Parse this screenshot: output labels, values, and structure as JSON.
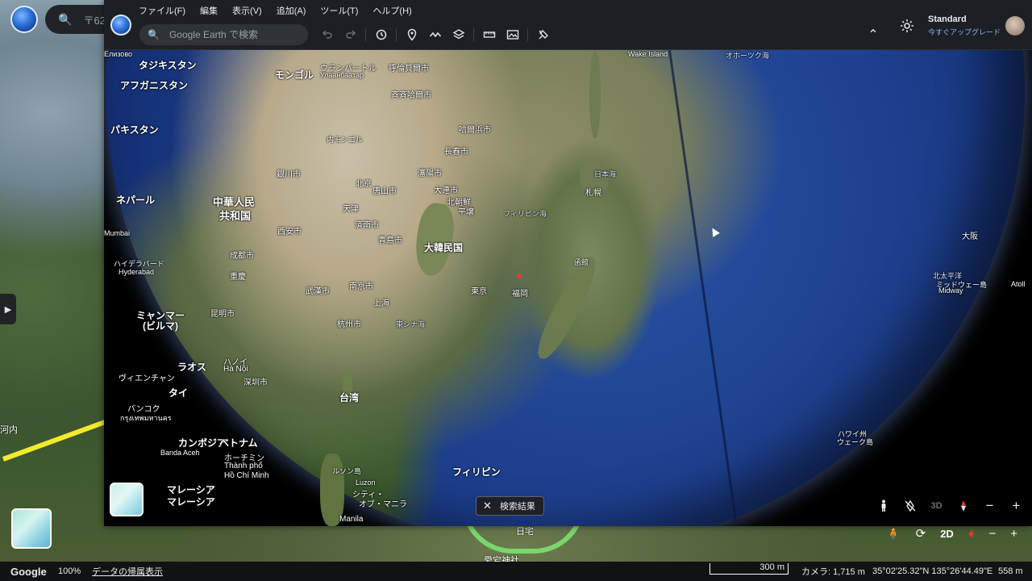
{
  "background": {
    "search_placeholder": "〒62",
    "label_left": "河内",
    "place_label_1": "日宅",
    "place_label_2": "愛宕神社",
    "controls": {
      "mode": "2D"
    },
    "status": {
      "google": "Google",
      "zoom": "100%",
      "attribution": "データの帰属表示",
      "scale": "300 m",
      "camera": "カメラ: 1,715 m",
      "coords": "35°02'25.32\"N 135°26'44.49\"E",
      "elevation": "558 m"
    }
  },
  "window": {
    "menu": [
      "ファイル(F)",
      "編集",
      "表示(V)",
      "追加(A)",
      "ツール(T)",
      "ヘルプ(H)"
    ],
    "search": {
      "placeholder": "Google Earth で検索"
    },
    "account": {
      "plan": "Standard",
      "upgrade": "今すぐアップグレード"
    },
    "search_results_label": "検索結果",
    "mode_3d": "3D",
    "map_labels": [
      {
        "text": "タジキスタン",
        "cls": "big"
      },
      {
        "text": "アフガニスタン",
        "cls": "big"
      },
      {
        "text": "モンゴル",
        "cls": "big"
      },
      {
        "text": "ウランバートル",
        "cls": ""
      },
      {
        "text": "Улаанбаатар",
        "cls": "small"
      },
      {
        "text": "呼倫貝爾市",
        "cls": ""
      },
      {
        "text": "斉斉哈爾市",
        "cls": ""
      },
      {
        "text": "哈爾浜市",
        "cls": ""
      },
      {
        "text": "長春市",
        "cls": ""
      },
      {
        "text": "パキスタン",
        "cls": "big"
      },
      {
        "text": "内モンゴル",
        "cls": "small"
      },
      {
        "text": "銀川市",
        "cls": ""
      },
      {
        "text": "北京",
        "cls": ""
      },
      {
        "text": "天津",
        "cls": ""
      },
      {
        "text": "唐山市",
        "cls": ""
      },
      {
        "text": "瀋陽市",
        "cls": ""
      },
      {
        "text": "大連市",
        "cls": ""
      },
      {
        "text": "平壌",
        "cls": ""
      },
      {
        "text": "北朝鮮",
        "cls": ""
      },
      {
        "text": "ネパール",
        "cls": "big"
      },
      {
        "text": "中華人民",
        "cls": "huge"
      },
      {
        "text": "共和国",
        "cls": "huge"
      },
      {
        "text": "済南市",
        "cls": ""
      },
      {
        "text": "青島市",
        "cls": ""
      },
      {
        "text": "大韓民国",
        "cls": "big"
      },
      {
        "text": "西安市",
        "cls": ""
      },
      {
        "text": "成都市",
        "cls": ""
      },
      {
        "text": "重慶",
        "cls": ""
      },
      {
        "text": "武漢市",
        "cls": ""
      },
      {
        "text": "南京市",
        "cls": ""
      },
      {
        "text": "上海",
        "cls": ""
      },
      {
        "text": "杭州市",
        "cls": ""
      },
      {
        "text": "東シナ海",
        "cls": "sea"
      },
      {
        "text": "Mumbai",
        "cls": "small"
      },
      {
        "text": "ハイデラバード",
        "cls": "small"
      },
      {
        "text": "Hyderabad",
        "cls": "small"
      },
      {
        "text": "ミャンマー",
        "cls": "big"
      },
      {
        "text": "(ビルマ)",
        "cls": "big"
      },
      {
        "text": "昆明市",
        "cls": ""
      },
      {
        "text": "ハノイ",
        "cls": ""
      },
      {
        "text": "Hà Nội",
        "cls": ""
      },
      {
        "text": "ラオス",
        "cls": "big"
      },
      {
        "text": "ヴィエンチャン",
        "cls": ""
      },
      {
        "text": "タイ",
        "cls": "big"
      },
      {
        "text": "深圳市",
        "cls": ""
      },
      {
        "text": "台湾",
        "cls": "big"
      },
      {
        "text": "バンコク",
        "cls": ""
      },
      {
        "text": "กรุงเทพมหานคร",
        "cls": "small"
      },
      {
        "text": "カンボジア",
        "cls": "big"
      },
      {
        "text": "ベトナム",
        "cls": "big"
      },
      {
        "text": "ホーチミン",
        "cls": ""
      },
      {
        "text": "Thành phố",
        "cls": ""
      },
      {
        "text": "Hồ Chí Minh",
        "cls": ""
      },
      {
        "text": "Banda Aceh",
        "cls": "small"
      },
      {
        "text": "マレーシア",
        "cls": "big"
      },
      {
        "text": "マレーシア",
        "cls": "big"
      },
      {
        "text": "ルソン島",
        "cls": "small"
      },
      {
        "text": "Luzon",
        "cls": "small"
      },
      {
        "text": "シティ・",
        "cls": ""
      },
      {
        "text": "オブ・マニラ",
        "cls": ""
      },
      {
        "text": "Manila",
        "cls": ""
      },
      {
        "text": "フィリピン",
        "cls": "big"
      },
      {
        "text": "フィリピン海",
        "cls": "sea"
      },
      {
        "text": "日本海",
        "cls": "sea"
      },
      {
        "text": "札幌",
        "cls": ""
      },
      {
        "text": "函館",
        "cls": "small"
      },
      {
        "text": "東京",
        "cls": ""
      },
      {
        "text": "福岡",
        "cls": ""
      },
      {
        "text": "大阪",
        "cls": ""
      },
      {
        "text": "北太平洋",
        "cls": "sea"
      },
      {
        "text": "ミッドウェー島",
        "cls": "small"
      },
      {
        "text": "Midway",
        "cls": "small"
      },
      {
        "text": "Atoll",
        "cls": "small"
      },
      {
        "text": "ハワイ州",
        "cls": "small"
      },
      {
        "text": "ウェーク島",
        "cls": "small"
      },
      {
        "text": "Wake Island",
        "cls": "small"
      },
      {
        "text": "オホーツク海",
        "cls": "sea"
      },
      {
        "text": "Елизово",
        "cls": "small"
      }
    ]
  }
}
